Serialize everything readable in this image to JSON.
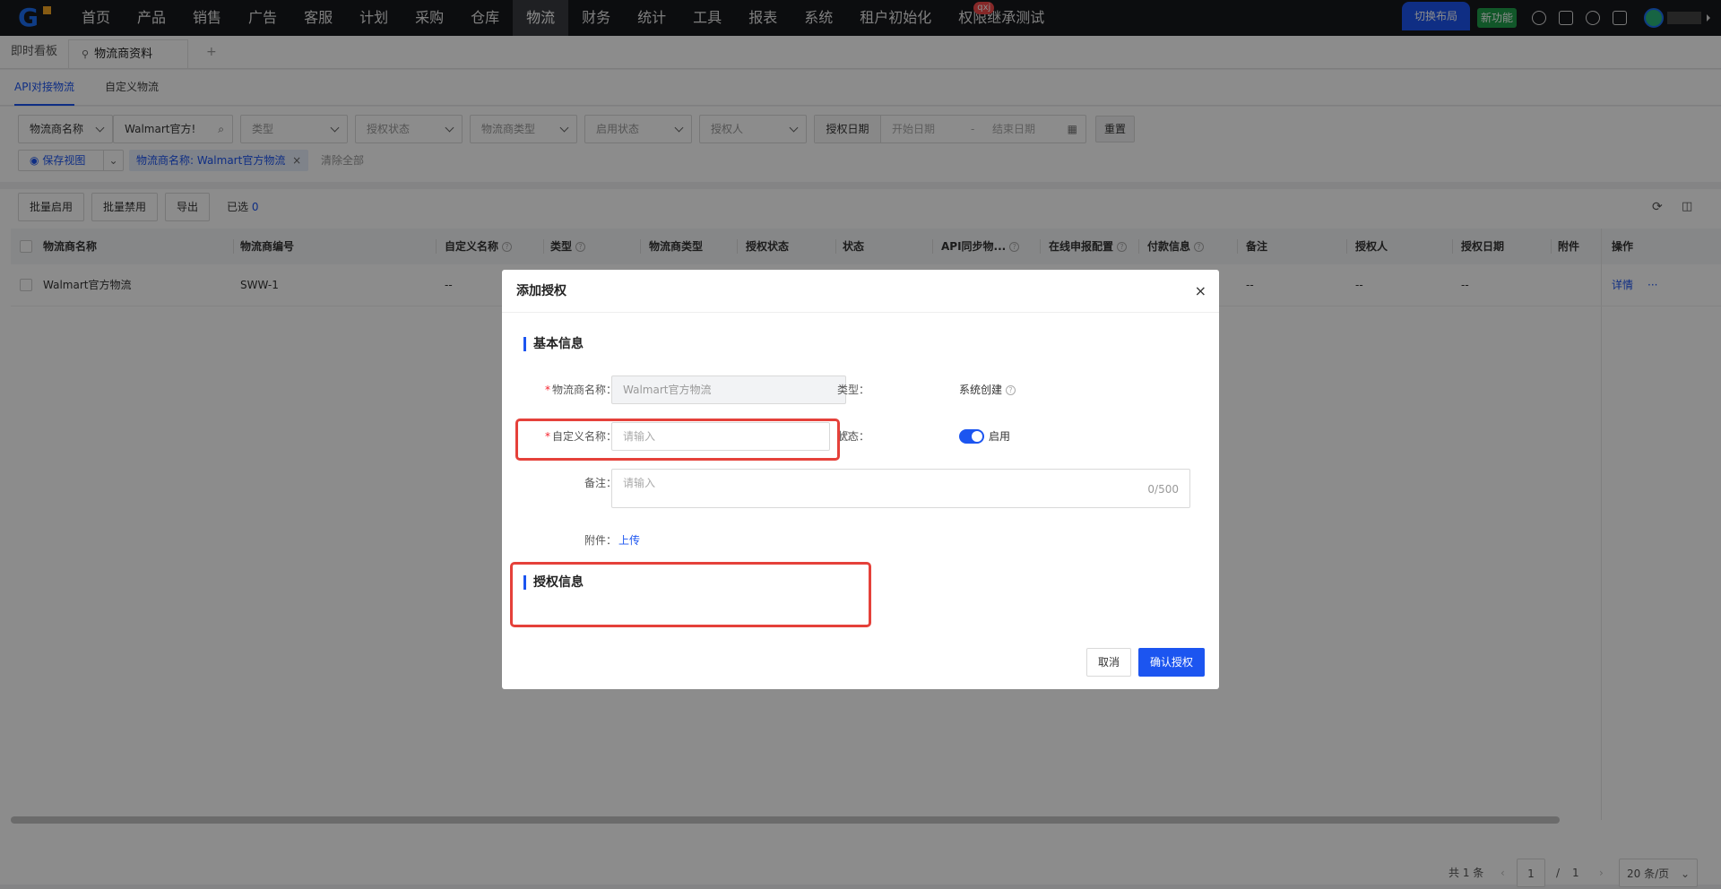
{
  "topnav": {
    "menu": [
      "首页",
      "产品",
      "销售",
      "广告",
      "客服",
      "计划",
      "采购",
      "仓库",
      "物流",
      "财务",
      "统计",
      "工具",
      "报表",
      "系统",
      "租户初始化",
      "权限继承测试"
    ],
    "active_index": 8,
    "badge": "qxj",
    "switch_label": "切换布局",
    "new_feature_label": "新功能"
  },
  "tabs": {
    "dashboard": "即时看板",
    "current": "物流商资料",
    "add": "+"
  },
  "subtabs": [
    "API对接物流",
    "自定义物流"
  ],
  "filters": {
    "name_field": "物流商名称",
    "name_value": "Walmart官方!",
    "type": "类型",
    "auth_status": "授权状态",
    "carrier_type": "物流商类型",
    "enable_status": "启用状态",
    "authorizer": "授权人",
    "auth_date": "授权日期",
    "start_date": "开始日期",
    "date_sep": "-",
    "end_date": "结束日期",
    "reset": "重置",
    "save_view": "保存视图",
    "chip": "物流商名称: Walmart官方物流",
    "clear_all": "清除全部"
  },
  "toolbar": {
    "batch_enable": "批量启用",
    "batch_disable": "批量禁用",
    "export": "导出",
    "selected_label": "已选",
    "selected_count": "0"
  },
  "table": {
    "headers": [
      "物流商名称",
      "物流商编号",
      "自定义名称",
      "类型",
      "物流商类型",
      "授权状态",
      "状态",
      "API同步物...",
      "在线申报配置",
      "付款信息",
      "备注",
      "授权人",
      "授权日期",
      "附件",
      "操作"
    ],
    "row": {
      "name": "Walmart官方物流",
      "code": "SWW-1",
      "custom": "--",
      "remark": "--",
      "authorizer": "--",
      "auth_date": "--",
      "detail": "详情",
      "more": "···"
    }
  },
  "pager": {
    "total": "共 1 条",
    "prev": "‹",
    "page": "1",
    "sep": "/",
    "pages": "1",
    "next": "›",
    "size": "20 条/页"
  },
  "modal": {
    "title": "添加授权",
    "close": "×",
    "section_basic": "基本信息",
    "label_name": "物流商名称：",
    "name_value": "Walmart官方物流",
    "label_type": "类型：",
    "type_value": "系统创建",
    "label_custom": "自定义名称：",
    "custom_placeholder": "请输入",
    "label_status": "状态：",
    "status_value": "启用",
    "label_remark": "备注：",
    "remark_placeholder": "请输入",
    "remark_counter": "0/500",
    "label_attach": "附件：",
    "upload": "上传",
    "section_auth": "授权信息",
    "cancel": "取消",
    "confirm": "确认授权"
  },
  "colors": {
    "primary": "#1c55f0",
    "highlight": "#e5413a"
  }
}
